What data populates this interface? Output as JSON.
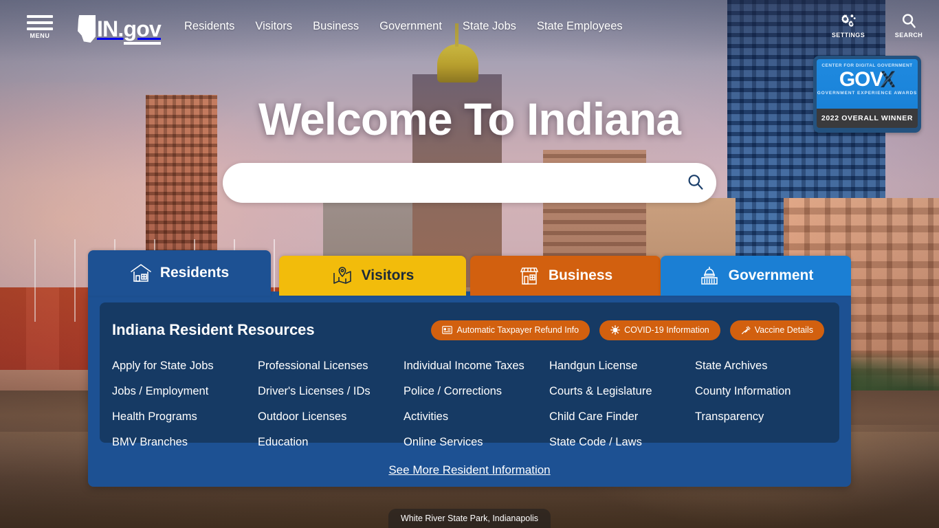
{
  "header": {
    "menu_label": "MENU",
    "logo_in": "IN",
    "logo_dot": ".",
    "logo_gov": "gov",
    "nav_items": [
      {
        "label": "Residents"
      },
      {
        "label": "Visitors"
      },
      {
        "label": "Business"
      },
      {
        "label": "Government"
      },
      {
        "label": "State Jobs"
      },
      {
        "label": "State Employees"
      }
    ],
    "utilities": [
      {
        "label": "SETTINGS",
        "icon": "gears-icon"
      },
      {
        "label": "SEARCH",
        "icon": "magnifier-icon"
      }
    ]
  },
  "award_badge": {
    "org": "CENTER FOR DIGITAL GOVERNMENT",
    "brand": "GOV",
    "brand_x": "X",
    "program": "GOVERNMENT EXPERIENCE AWARDS",
    "accolade": "2022 OVERALL WINNER",
    "blue": "#1a82d8",
    "dark": "#3a3a3c"
  },
  "hero": {
    "title": "Welcome To Indiana",
    "search_value": "",
    "search_placeholder": "",
    "search_icon": "magnifier-icon"
  },
  "tabs": [
    {
      "label": "Residents",
      "icon": "house-icon",
      "active": true,
      "color": "#1d5193"
    },
    {
      "label": "Visitors",
      "icon": "map-pin-icon",
      "active": false,
      "color": "#f2bc0b"
    },
    {
      "label": "Business",
      "icon": "storefront-icon",
      "active": false,
      "color": "#d2600f"
    },
    {
      "label": "Government",
      "icon": "capitol-icon",
      "active": false,
      "color": "#1b7fd4"
    }
  ],
  "panel": {
    "title": "Indiana Resident Resources",
    "pills": [
      {
        "label": "Automatic Taxpayer Refund Info",
        "icon": "id-card-icon"
      },
      {
        "label": "COVID-19 Information",
        "icon": "virus-icon"
      },
      {
        "label": "Vaccine Details",
        "icon": "syringe-icon"
      }
    ],
    "links": [
      "Apply for State Jobs",
      "Professional Licenses",
      "Individual Income Taxes",
      "Handgun License",
      "State Archives",
      "Jobs / Employment",
      "Driver's Licenses / IDs",
      "Police / Corrections",
      "Courts & Legislature",
      "County Information",
      "Health Programs",
      "Outdoor Licenses",
      "Activities",
      "Child Care Finder",
      "Transparency",
      "BMV Branches",
      "Education",
      "Online Services",
      "State Code / Laws",
      ""
    ],
    "see_more": "See More Resident Information"
  },
  "photo_caption": "White River State Park, Indianapolis"
}
